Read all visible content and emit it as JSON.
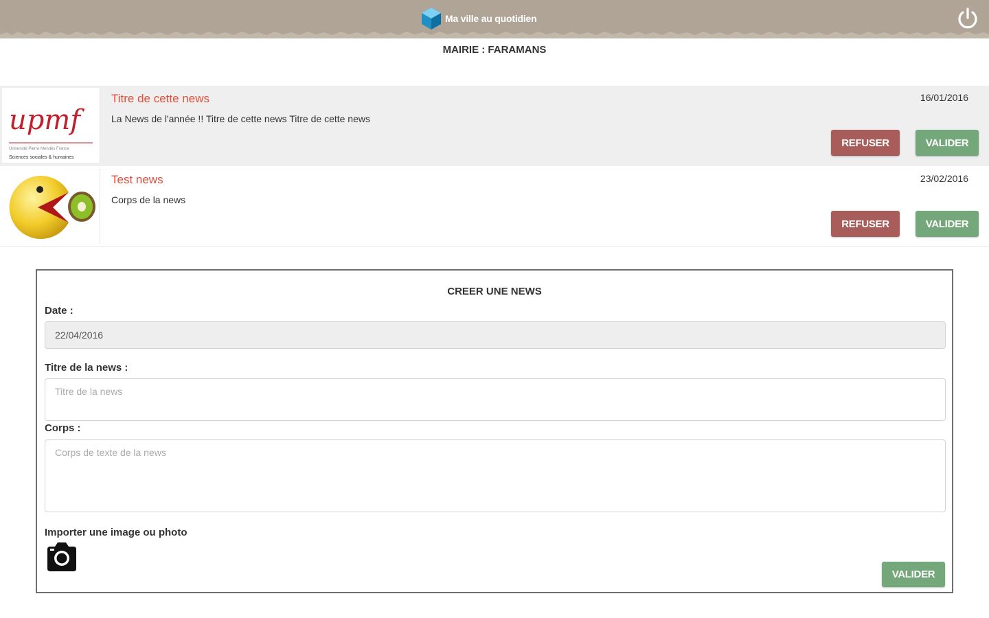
{
  "header": {
    "app_name": "Ma ville au quotidien",
    "logo_icon": "cube-logo-icon",
    "power_icon": "power-icon",
    "background_color": "#b0a497"
  },
  "mairie_label": "MAIRIE : FARAMANS",
  "news": [
    {
      "title": "Titre de cette news",
      "body": "La News de l'année !! Titre de cette news Titre de cette news",
      "date": "16/01/2016",
      "refuse_label": "REFUSER",
      "validate_label": "VALIDER",
      "thumbnail": "upmf-logo-image",
      "thumbnail_text": {
        "logo": "upmf",
        "line1": "Université Pierre Mendès France",
        "line2": "Sciences sociales & humaines"
      }
    },
    {
      "title": "Test news",
      "body": "Corps de la news",
      "date": "23/02/2016",
      "refuse_label": "REFUSER",
      "validate_label": "VALIDER",
      "thumbnail": "pacman-kiwi-image"
    }
  ],
  "form": {
    "title": "CREER UNE NEWS",
    "date_label": "Date :",
    "date_value": "22/04/2016",
    "title_label": "Titre de la news :",
    "title_placeholder": "Titre de la news",
    "body_label": "Corps :",
    "body_placeholder": "Corps de texte de la news",
    "import_label": "Importer une image ou photo",
    "camera_icon": "camera-icon",
    "submit_label": "VALIDER"
  },
  "colors": {
    "title_red": "#e0503a",
    "refuse": "#a85d5b",
    "validate": "#74a779"
  }
}
